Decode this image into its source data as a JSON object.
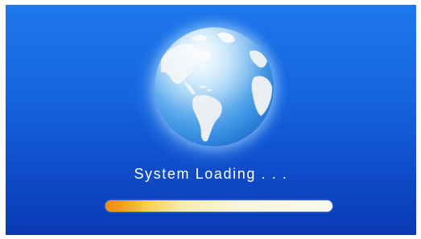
{
  "loading": {
    "message": "System Loading . . .",
    "progress": 1.0
  },
  "icons": {
    "globe": "globe-icon"
  },
  "colors": {
    "background_top": "#1d78ea",
    "background_bottom": "#0a3ab4",
    "progress_start": "#f08a00",
    "progress_end": "#fcfbf0",
    "text": "#ffffff"
  }
}
